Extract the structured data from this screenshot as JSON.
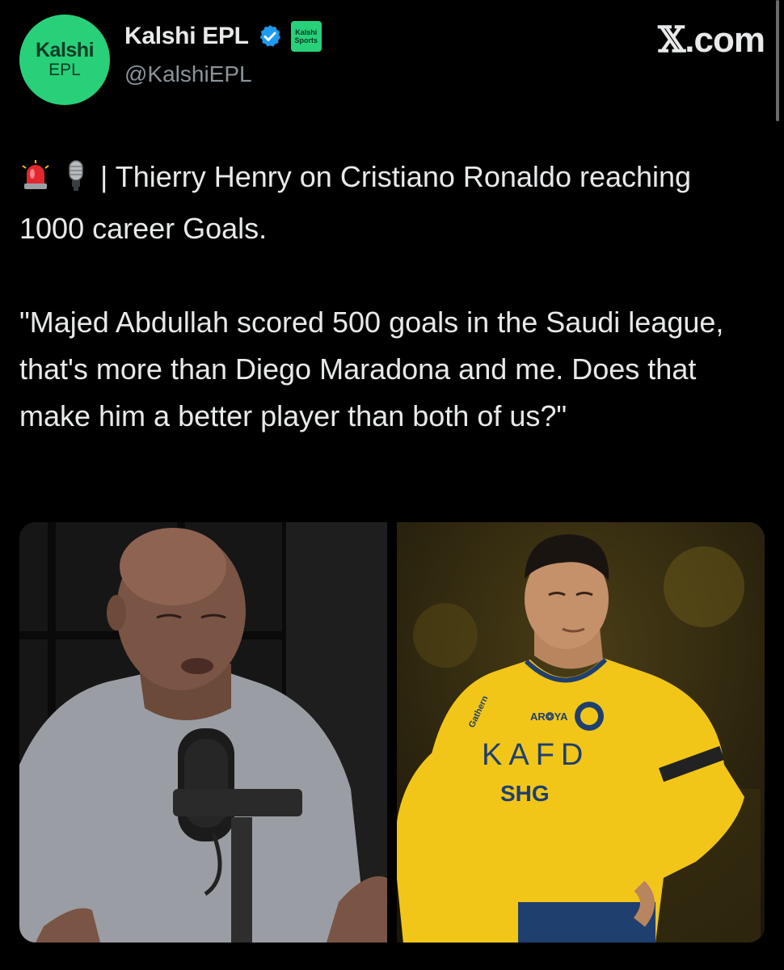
{
  "author": {
    "avatar_line1": "Kalshi",
    "avatar_line2": "EPL",
    "display_name": "Kalshi EPL",
    "handle": "@KalshiEPL",
    "verified": true,
    "affiliate_badge_line1": "Kalshi",
    "affiliate_badge_line2": "Sports",
    "avatar_color": "#28d07a"
  },
  "brand": {
    "x_glyph": "𝕏",
    "domain": ".com"
  },
  "tweet": {
    "emojis": [
      "rotating-light-icon",
      "microphone-icon"
    ],
    "line1": "| Thierry Henry on Cristiano Ronaldo reaching 1000 career Goals.",
    "quote": "\"Majed Abdullah scored 500 goals in the Saudi league, that's more than Diego Maradona and me. Does that make him a better player than both of us?\""
  },
  "media": {
    "jersey_sponsor": "KAFD",
    "jersey_sponsor2": "SHG",
    "jersey_brand": "AR❂YA",
    "jersey_sleeve": "Gathern"
  },
  "colors": {
    "background": "#000000",
    "text": "#e7e9ea",
    "secondary": "#8b949b",
    "verified": "#1d9bf0",
    "jersey": "#f2c618"
  }
}
